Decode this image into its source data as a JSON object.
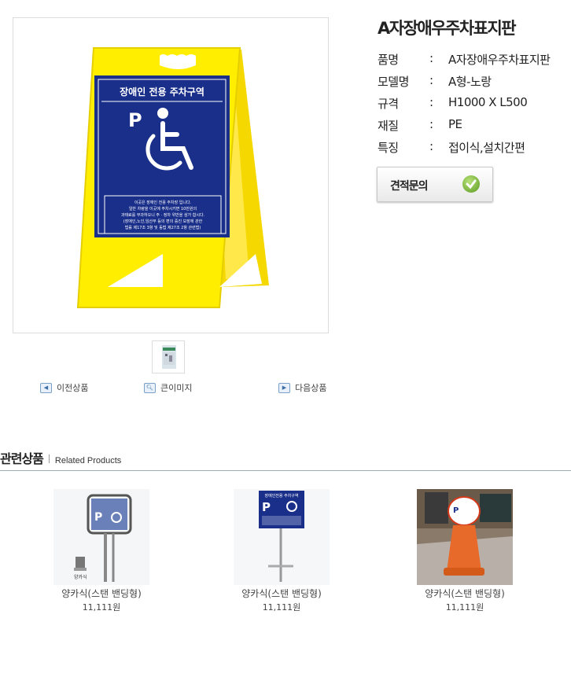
{
  "product": {
    "name": "A자장애우주차표지판",
    "specs": [
      {
        "label": "품명",
        "sep": ":",
        "value": "A자장애우주차표지판"
      },
      {
        "label": "모델명",
        "sep": ":",
        "value": "A형-노랑"
      },
      {
        "label": "규격",
        "sep": ":",
        "value": "H1000 X L500"
      },
      {
        "label": "재질",
        "sep": ":",
        "value": "PE"
      },
      {
        "label": "특징",
        "sep": ":",
        "value": "접이식,설치간편"
      }
    ],
    "quote_button": "견적문의"
  },
  "sign": {
    "title": "장애인 전용 주차구역",
    "p": "P",
    "notice": [
      "이곳은 장애인 전용 주차장 입니다.",
      "일반 차량을 이곳에 주차시키면 10만원의",
      "과태료를 부과하오니 주 · 정차 위반을 삼가 합시다.",
      "(장애인,노인,임산부 등의 편의 증진 보장에 관한",
      "법률 제17조 3항 및 동법 제27조 2항 관련법)"
    ]
  },
  "nav": {
    "prev": "이전상품",
    "zoom": "큰이미지",
    "next": "다음상품"
  },
  "related": {
    "title": "관련상품",
    "subtitle": "Related Products",
    "items": [
      {
        "name": "양카식(스탠 밴딩형)",
        "price": "11,111원",
        "tag": "양카식"
      },
      {
        "name": "양카식(스탠 밴딩형)",
        "price": "11,111원",
        "sign_title": "장애인전용 주차구역"
      },
      {
        "name": "양카식(스탠 밴딩형)",
        "price": "11,111원"
      }
    ]
  },
  "colors": {
    "sign_yellow": "#ffee00",
    "sign_blue": "#1a2f8a",
    "check_green": "#5a9a1e",
    "cone_orange": "#e86a2a"
  }
}
